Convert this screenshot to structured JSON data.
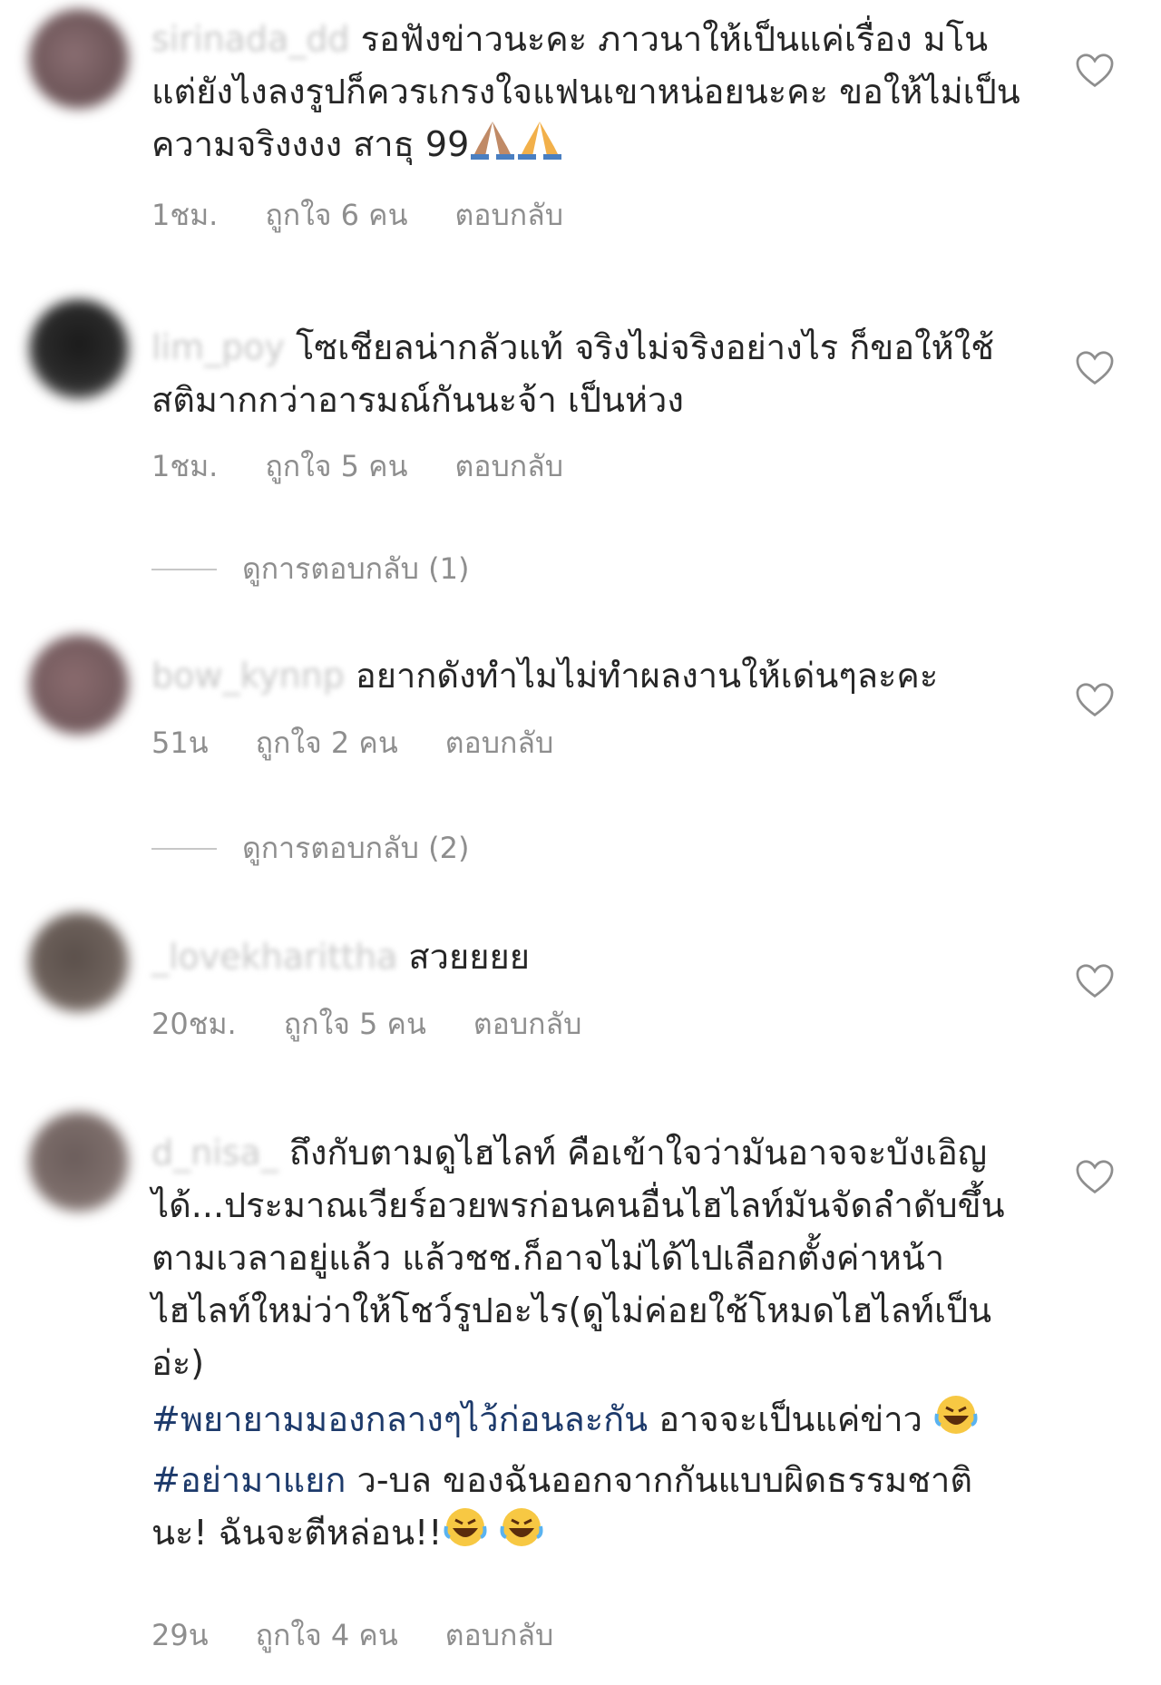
{
  "comments": [
    {
      "username": "sirinada_dd",
      "text": "รอฟังข่าวนะคะ ภาวนาให้เป็นแค่เรื่อง มโน แต่ยังไงลงรูปก็ควรเกรงใจแฟนเขาหน่อยนะคะ ขอให้ไม่เป็นความจริงงงง สาธุ 99",
      "time": "1ชม.",
      "likes": "ถูกใจ 6 คน",
      "reply": "ตอบกลับ"
    },
    {
      "username": "lim_poy",
      "text": "โซเชียลน่ากลัวแท้ จริงไม่จริงอย่างไร ก็ขอให้ใช้สติมากกว่าอารมณ์กันนะจ้า เป็นห่วง",
      "time": "1ชม.",
      "likes": "ถูกใจ 5 คน",
      "reply": "ตอบกลับ",
      "view_replies": "ดูการตอบกลับ (1)"
    },
    {
      "username": "bow_kynnp",
      "text": "อยากดังทำไมไม่ทำผลงานให้เด่นๆละคะ",
      "time": "51น",
      "likes": "ถูกใจ 2 คน",
      "reply": "ตอบกลับ",
      "view_replies": "ดูการตอบกลับ (2)"
    },
    {
      "username": "_lovekharittha",
      "text": "สวยยยย",
      "time": "20ชม.",
      "likes": "ถูกใจ 5 คน",
      "reply": "ตอบกลับ"
    },
    {
      "username": "d_nisa_",
      "text_1": "ถึงกับตามดูไฮไลท์ คือเข้าใจว่ามันอาจจะบังเอิญได้...ประมาณเวียร์อวยพรก่อนคนอื่นไฮไลท์มันจัดลำดับขึ้นตามเวลาอยู่แล้ว แล้วชช.ก็อาจไม่ได้ไปเลือกตั้งค่าหน้าไฮไลท์ใหม่ว่าให้โชว์รูปอะไร(ดูไม่ค่อยใช้โหมดไฮไลท์เป็นอ่ะ)",
      "hashtag_1": "#พยายามมองกลางๆไว้ก่อนละกัน",
      "text_2": " อาจจะเป็นแค่ข่าว",
      "hashtag_2": "#อย่ามาแยก",
      "text_3": " ว-บล ของฉันออกจากกันแบบผิดธรรมชาตินะ! ฉันจะตีหล่อน!!",
      "time": "29น",
      "likes": "ถูกใจ 4 คน",
      "reply": "ตอบกลับ"
    }
  ],
  "icons": {
    "heart": "heart-outline-icon",
    "pray": "folded-hands-emoji",
    "laugh": "tears-of-joy-emoji"
  },
  "colors": {
    "text": "#262626",
    "meta": "#8e8e8e",
    "hashtag": "#1d3a6b",
    "heart_stroke": "#8e8e8e"
  }
}
